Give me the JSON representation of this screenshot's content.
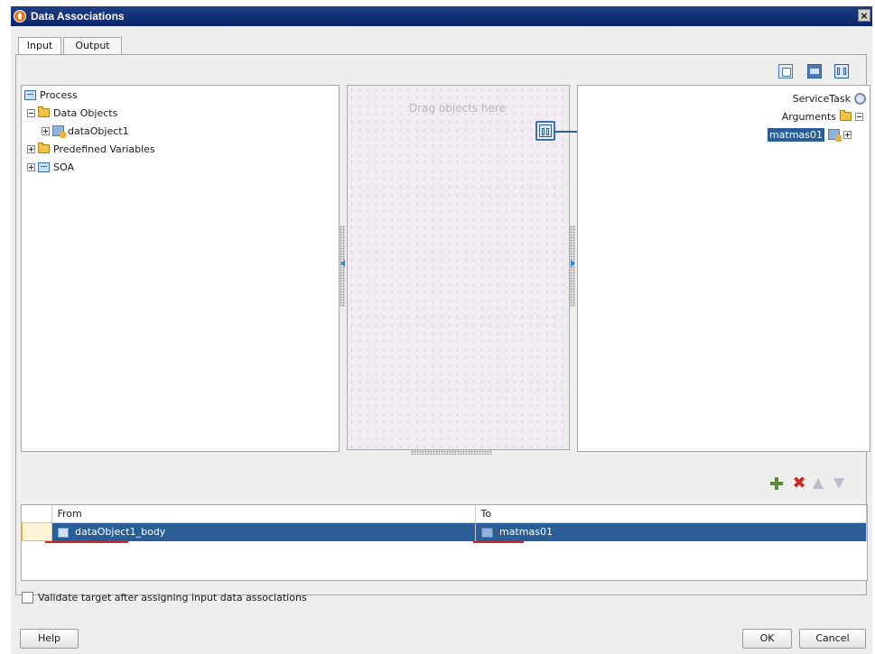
{
  "window": {
    "title": "Data Associations",
    "close_glyph": "×"
  },
  "tabs": [
    {
      "label": "Input",
      "active": true
    },
    {
      "label": "Output",
      "active": false
    }
  ],
  "source_tree": {
    "items": [
      {
        "label": "Process",
        "icon": "process-icon",
        "expanded": true
      },
      {
        "label": "Data Objects",
        "icon": "folder-icon",
        "expanded": true
      },
      {
        "label": "dataObject1",
        "icon": "data-object-icon",
        "expanded": false
      },
      {
        "label": "Predefined Variables",
        "icon": "folder-icon",
        "expanded": false
      },
      {
        "label": "SOA",
        "icon": "process-icon",
        "expanded": false
      }
    ]
  },
  "mapper": {
    "hint": "Drag objects here"
  },
  "target_tree": {
    "root": "ServiceTask",
    "arguments": "Arguments",
    "selected_item": "matmas01"
  },
  "grid": {
    "columns": [
      "From",
      "To"
    ],
    "rows": [
      {
        "from": "dataObject1_body",
        "to": "matmas01",
        "selected": true
      }
    ]
  },
  "validate": {
    "label": "Validate target after assigning input data associations",
    "checked": false
  },
  "buttons": {
    "help": "Help",
    "ok": "OK",
    "cancel": "Cancel"
  },
  "colors": {
    "title_bar": "#0a246a",
    "selection": "#2b5e96",
    "delete": "#d32424",
    "add": "#5a8a3a"
  }
}
